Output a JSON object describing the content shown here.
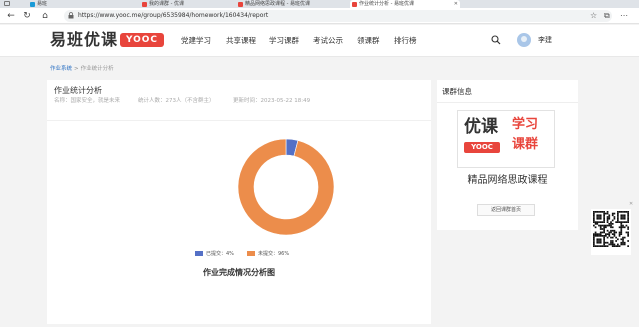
{
  "browser": {
    "tabs": [
      {
        "title": "易班",
        "icon_color": "#1a9bd7"
      },
      {
        "title": "我的课群 - 优课",
        "icon_color": "#e8453c"
      },
      {
        "title": "精品网络思政课程 - 易班优课",
        "icon_color": "#e8453c"
      },
      {
        "title": "作业统计分析 - 易班优课",
        "icon_color": "#e8453c"
      }
    ],
    "url": "https://www.yooc.me/group/6535984/homework/160434/report"
  },
  "header": {
    "logo_text": "易班优课",
    "logo_badge": "YOOC",
    "nav": [
      "党建学习",
      "共享课程",
      "学习课群",
      "考试公示",
      "领课群",
      "排行榜"
    ],
    "username": "李建"
  },
  "breadcrumb": {
    "link": "作业系统",
    "sep": ">",
    "current": "作业统计分析"
  },
  "main": {
    "title": "作业统计分析",
    "meta_name": "名称：国家安全，就是未来",
    "meta_count": "统计人数：273人（不含群主）",
    "meta_time": "更新时间：2023-05-22 18:49"
  },
  "chart_data": {
    "type": "pie",
    "title": "作业完成情况分析图",
    "categories": [
      "已提交",
      "未提交"
    ],
    "values": [
      4,
      96
    ],
    "unit": "%",
    "colors": [
      "#5470c6",
      "#ec8d4b"
    ],
    "legend": [
      "已提交：4%",
      "未提交：96%"
    ],
    "legend_position": "bottom"
  },
  "side": {
    "title": "课群信息",
    "poster": {
      "left": "优课",
      "badge": "YOOC",
      "right1": "学习",
      "right2": "课群"
    },
    "course_name": "精品网络思政课程",
    "button": "返回课群首页"
  },
  "icons": [
    "back-icon",
    "refresh-icon",
    "home-icon",
    "lock-icon",
    "search-icon",
    "favorite-icon",
    "settings-icon",
    "qr-code-icon"
  ]
}
